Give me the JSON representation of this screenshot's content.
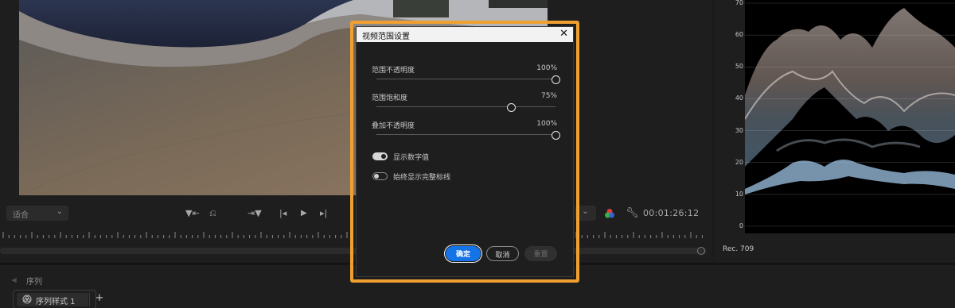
{
  "monitor": {
    "fit_label": "适合",
    "timecode": "00:01:26:12",
    "transport_icons": [
      "mark-in-icon",
      "mark-out-icon",
      "go-to-in-icon",
      "step-back-icon",
      "play-icon",
      "step-forward-icon"
    ]
  },
  "scopes": {
    "scale": [
      "70",
      "60",
      "50",
      "40",
      "30",
      "20",
      "10",
      "0"
    ],
    "colorspace": "Rec. 709"
  },
  "panel": {
    "sequence_label": "序列",
    "tab_label": "序列样式 1",
    "add_label": "+"
  },
  "dialog": {
    "title": "视频范围设置",
    "close": "✕",
    "sliders": [
      {
        "label": "范围不透明度",
        "value_text": "100%",
        "value": 1.0
      },
      {
        "label": "范围饱和度",
        "value_text": "75%",
        "value": 0.75
      },
      {
        "label": "叠加不透明度",
        "value_text": "100%",
        "value": 1.0
      }
    ],
    "toggles": [
      {
        "label": "显示数字值",
        "on": true
      },
      {
        "label": "始终显示完整标线",
        "on": false
      }
    ],
    "ok_label": "确定",
    "cancel_label": "取消",
    "reset_label": "重置"
  },
  "colors": {
    "accent": "#1473e6",
    "highlight": "#f0a030"
  }
}
